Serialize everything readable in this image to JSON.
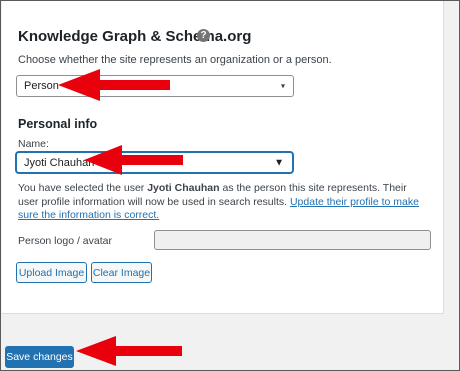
{
  "section": {
    "title": "Knowledge Graph & Schema.org",
    "help_glyph": "?",
    "description": "Choose whether the site represents an organization or a person."
  },
  "represents_select": {
    "value": "Person",
    "arrow": "▾"
  },
  "personal_info": {
    "heading": "Personal info",
    "name_label": "Name:",
    "name_select": {
      "value": "Jyoti Chauhan",
      "arrow": "▼"
    },
    "notice_before": "You have selected the user ",
    "notice_user": "Jyoti Chauhan",
    "notice_after": " as the person this site represents. Their user profile information will now be used in search results. ",
    "notice_link": "Update their profile to make sure the information is correct."
  },
  "logo": {
    "label": "Person logo / avatar",
    "upload_label": "Upload Image",
    "clear_label": "Clear Image"
  },
  "footer": {
    "save_label": "Save changes"
  },
  "colors": {
    "accent": "#2271b1",
    "annotation_arrow": "#e8000d",
    "panel_bg": "#ffffff",
    "page_bg": "#f1f1f1"
  },
  "icons": {
    "help": "help-icon",
    "dropdown": "chevron-down-icon",
    "annotation": "red-arrow-icon"
  }
}
